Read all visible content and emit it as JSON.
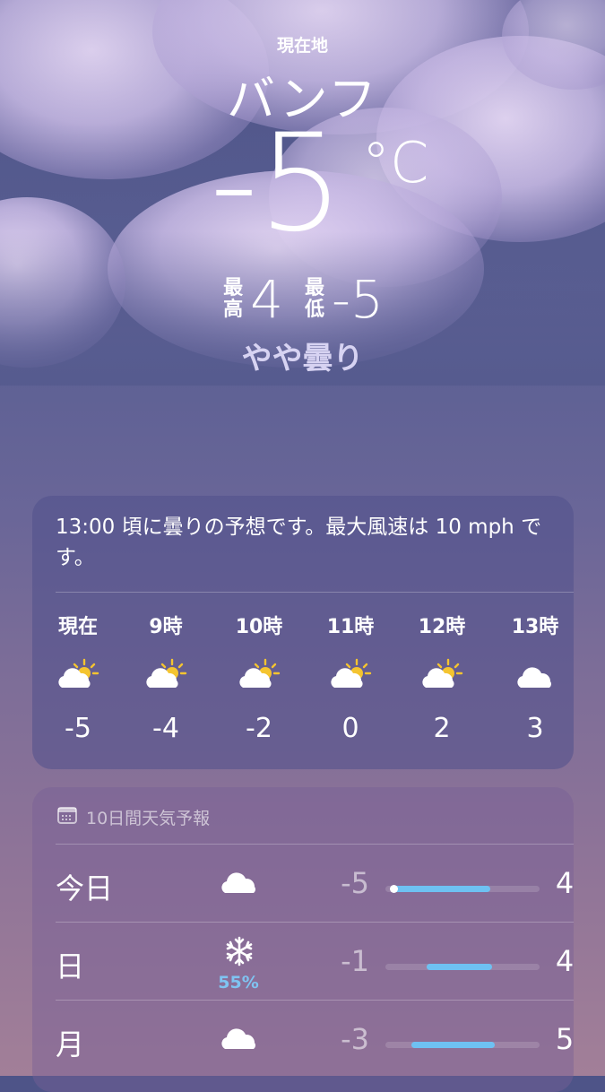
{
  "header": {
    "location_label": "現在地",
    "city": "バンフ",
    "current_temp": "-5",
    "unit": "°C",
    "high_label": "最高",
    "high": "4",
    "low_label": "最低",
    "low": "-5",
    "condition": "やや曇り"
  },
  "hourly": {
    "summary": "13:00 頃に曇りの予想です。最大風速は 10 mph です。",
    "items": [
      {
        "label": "現在",
        "icon": "partly-sunny-icon",
        "temp": "-5"
      },
      {
        "label": "9時",
        "icon": "partly-sunny-icon",
        "temp": "-4"
      },
      {
        "label": "10時",
        "icon": "partly-sunny-icon",
        "temp": "-2"
      },
      {
        "label": "11時",
        "icon": "partly-sunny-icon",
        "temp": "0"
      },
      {
        "label": "12時",
        "icon": "partly-sunny-icon",
        "temp": "2"
      },
      {
        "label": "13時",
        "icon": "cloud-icon",
        "temp": "3"
      }
    ]
  },
  "forecast": {
    "title": "10日間天気予報",
    "icon": "calendar-icon",
    "days": [
      {
        "day": "今日",
        "icon": "cloud-icon",
        "precip": "",
        "low": "-5",
        "high": "4",
        "range_start": 0.05,
        "range_end": 0.68,
        "current": 0.05
      },
      {
        "day": "日",
        "icon": "snowflake-icon",
        "precip": "55%",
        "low": "-1",
        "high": "4",
        "range_start": 0.27,
        "range_end": 0.69
      },
      {
        "day": "月",
        "icon": "cloud-icon",
        "precip": "",
        "low": "-3",
        "high": "5",
        "range_start": 0.17,
        "range_end": 0.71
      }
    ]
  },
  "colors": {
    "range_bar": "#6ec1f2",
    "precip": "#7fc4f2"
  }
}
